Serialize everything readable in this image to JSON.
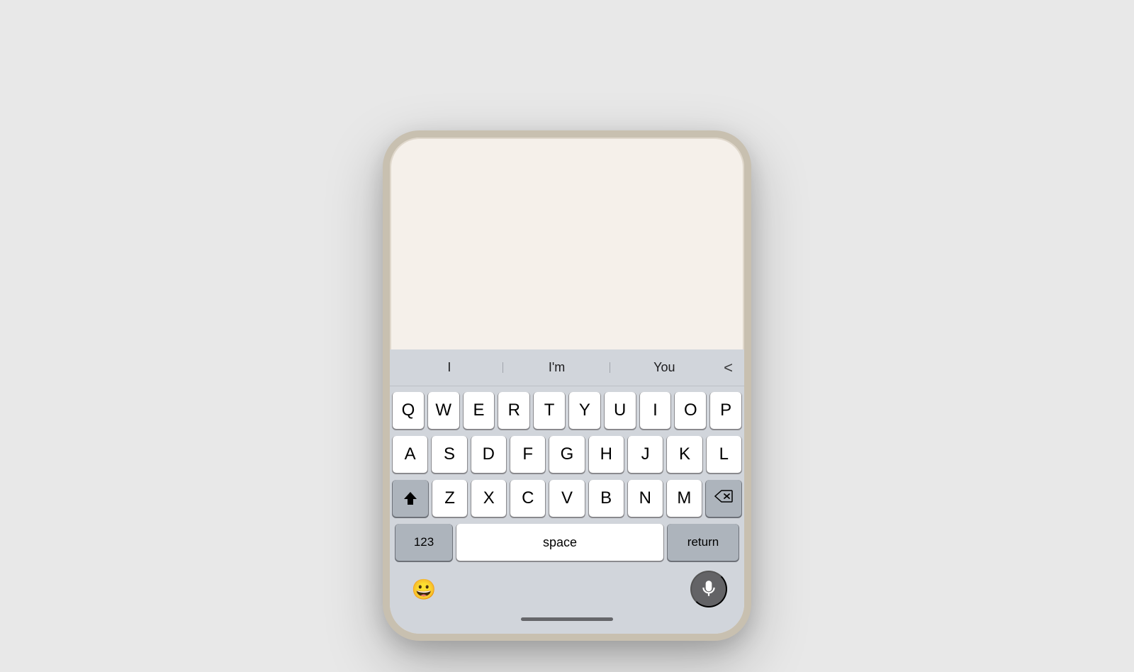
{
  "autocomplete": {
    "suggestions": [
      "I",
      "I'm",
      "You"
    ],
    "dismiss_icon": "<"
  },
  "keyboard": {
    "rows": [
      [
        "Q",
        "W",
        "E",
        "R",
        "T",
        "Y",
        "U",
        "I",
        "O",
        "P"
      ],
      [
        "A",
        "S",
        "D",
        "F",
        "G",
        "H",
        "J",
        "K",
        "L"
      ],
      [
        "Z",
        "X",
        "C",
        "V",
        "B",
        "N",
        "M"
      ]
    ],
    "bottom_row": {
      "numbers_label": "123",
      "space_label": "space",
      "return_label": "return"
    }
  },
  "toolbar": {
    "emoji_icon": "😀",
    "mic_label": "dictation"
  }
}
